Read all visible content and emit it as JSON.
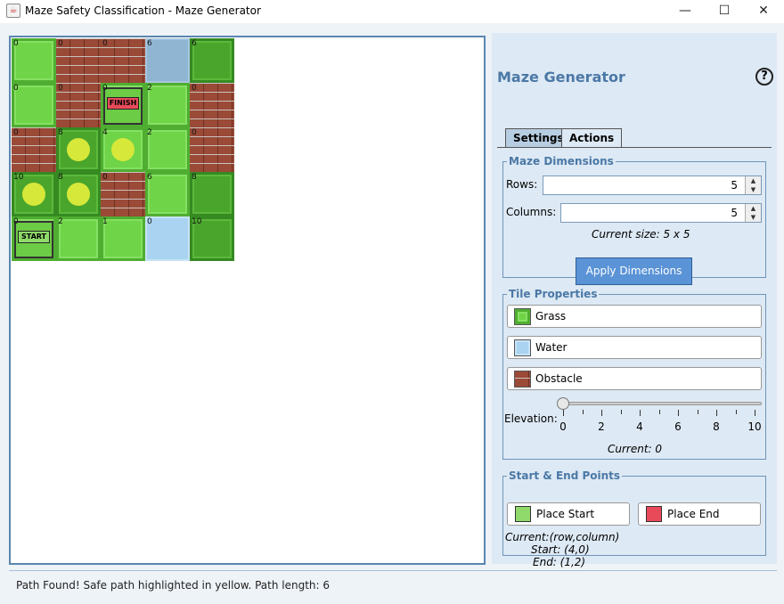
{
  "window": {
    "title": "Maze Safety Classification - Maze Generator",
    "app_icon": "java-cup-icon",
    "minimize": "—",
    "maximize": "☐",
    "close": "✕"
  },
  "maze": {
    "rows": [
      [
        {
          "type": "grass",
          "elev": "0"
        },
        {
          "type": "obstacle",
          "elev": "0"
        },
        {
          "type": "obstacle",
          "elev": "0"
        },
        {
          "type": "water-dark",
          "elev": "6"
        },
        {
          "type": "grass-dark",
          "elev": "6"
        }
      ],
      [
        {
          "type": "grass",
          "elev": "0"
        },
        {
          "type": "obstacle",
          "elev": "0"
        },
        {
          "type": "finish",
          "elev": "0",
          "label": "FINISH"
        },
        {
          "type": "grass",
          "elev": "2"
        },
        {
          "type": "obstacle",
          "elev": "0"
        }
      ],
      [
        {
          "type": "obstacle",
          "elev": "0"
        },
        {
          "type": "grass-dark-safe",
          "elev": "8"
        },
        {
          "type": "grass-safe",
          "elev": "4"
        },
        {
          "type": "grass",
          "elev": "2"
        },
        {
          "type": "obstacle",
          "elev": "0"
        }
      ],
      [
        {
          "type": "grass-dark-safe",
          "elev": "10"
        },
        {
          "type": "grass-dark-safe",
          "elev": "8"
        },
        {
          "type": "obstacle",
          "elev": "0"
        },
        {
          "type": "grass",
          "elev": "6"
        },
        {
          "type": "grass-dark",
          "elev": "8"
        }
      ],
      [
        {
          "type": "start",
          "elev": "0",
          "label": "START"
        },
        {
          "type": "grass",
          "elev": "2"
        },
        {
          "type": "grass",
          "elev": "1"
        },
        {
          "type": "water",
          "elev": "0"
        },
        {
          "type": "grass-dark",
          "elev": "10"
        }
      ]
    ]
  },
  "side": {
    "heading": "Maze Generator",
    "help": "?",
    "tabs": [
      "Settings",
      "Actions"
    ],
    "active_tab": "Settings",
    "dimensions": {
      "legend": "Maze Dimensions",
      "rows_label": "Rows:",
      "rows_value": "5",
      "cols_label": "Columns:",
      "cols_value": "5",
      "current_size": "Current size: 5 x 5",
      "apply": "Apply Dimensions"
    },
    "tiles": {
      "legend": "Tile Properties",
      "grass": "Grass",
      "water": "Water",
      "obstacle": "Obstacle",
      "elevation_label": "Elevation:",
      "ticks": [
        "0",
        "2",
        "4",
        "6",
        "8",
        "10"
      ],
      "elevation_value": 0,
      "current": "Current: 0"
    },
    "points": {
      "legend": "Start & End Points",
      "place_start": "Place Start",
      "place_end": "Place End",
      "current": "Current:(row,column)",
      "start": "Start: (4,0)",
      "end": "End: (1,2)"
    }
  },
  "status": "Path Found! Safe path highlighted in yellow. Path length: 6",
  "colors": {
    "accent": "#4b78a6",
    "button": "#5a93d6",
    "safe_path": "#d6e83a"
  }
}
